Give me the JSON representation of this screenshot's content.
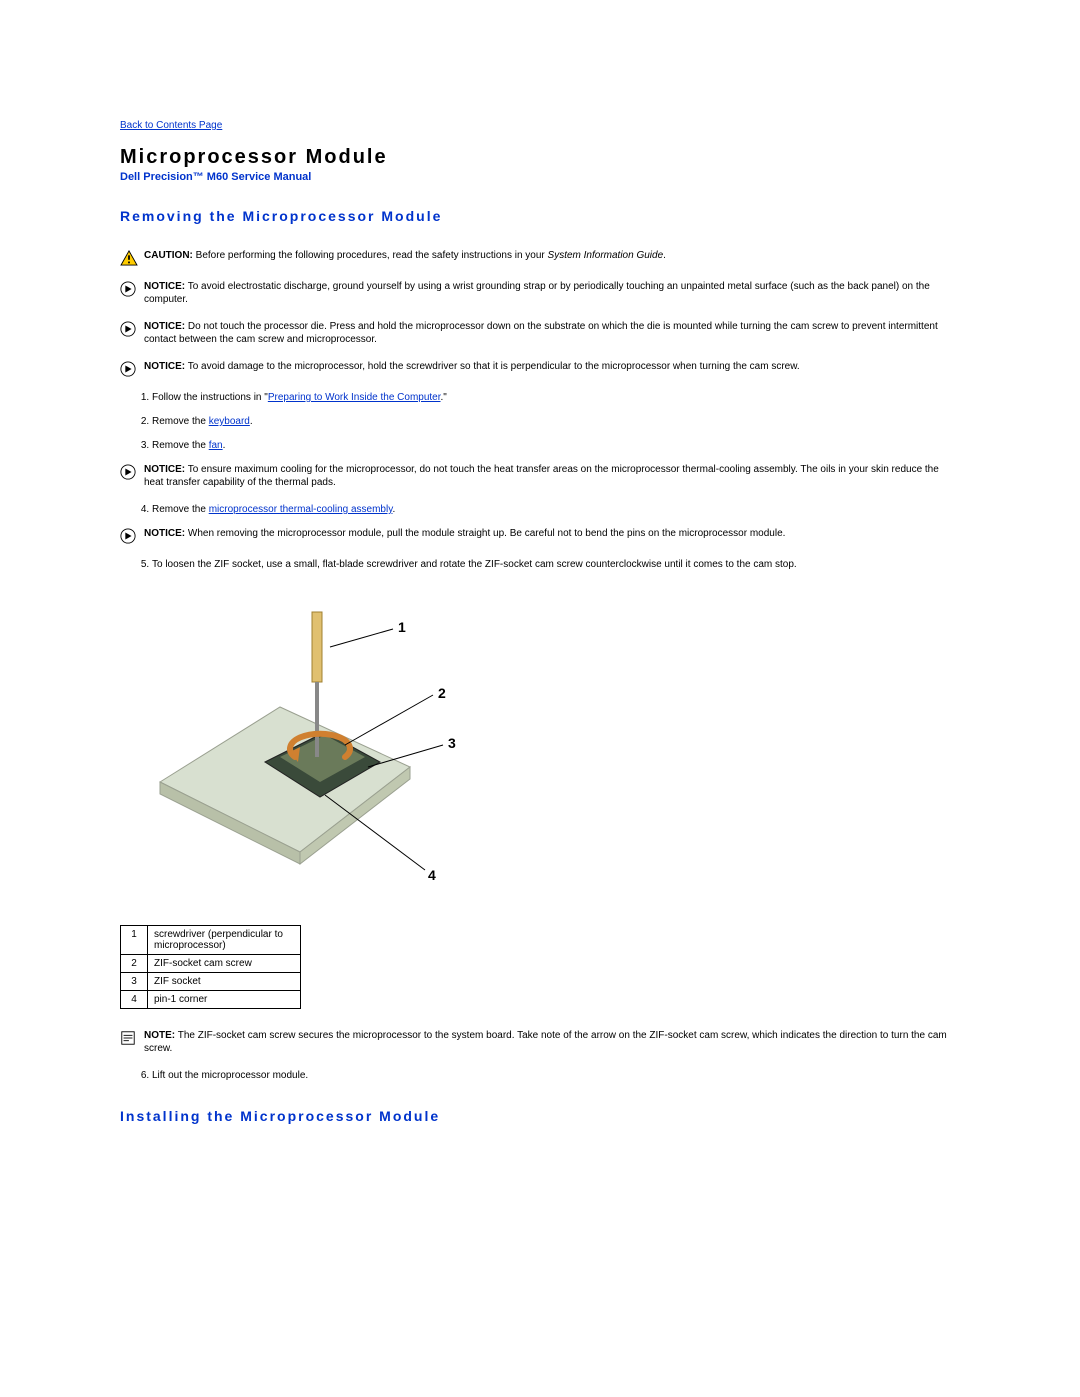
{
  "top_link": "Back to Contents Page",
  "page_title": "Microprocessor Module",
  "subtitle": "Dell Precision™ M60 Service Manual",
  "section1_title": "Removing the Microprocessor Module",
  "caution": {
    "label": "CAUTION:",
    "text": " Before performing the following procedures, read the safety instructions in your ",
    "italic": "System Information Guide",
    "suffix": "."
  },
  "notice1": {
    "label": "NOTICE:",
    "text": " To avoid electrostatic discharge, ground yourself by using a wrist grounding strap or by periodically touching an unpainted metal surface (such as the back panel) on the computer."
  },
  "notice2": {
    "label": "NOTICE:",
    "text": " Do not touch the processor die. Press and hold the microprocessor down on the substrate on which the die is mounted while turning the cam screw to prevent intermittent contact between the cam screw and microprocessor."
  },
  "notice3": {
    "label": "NOTICE:",
    "text": " To avoid damage to the microprocessor, hold the screwdriver so that it is perpendicular to the microprocessor when turning the cam screw."
  },
  "step1_prefix": "Follow the instructions in \"",
  "step1_link": "Preparing to Work Inside the Computer",
  "step1_suffix": ".\"",
  "step2_prefix": "Remove the ",
  "step2_link": "keyboard",
  "step2_suffix": ".",
  "step3_prefix": "Remove the ",
  "step3_link": "fan",
  "step3_suffix": ".",
  "notice4": {
    "label": "NOTICE:",
    "text": " To ensure maximum cooling for the microprocessor, do not touch the heat transfer areas on the microprocessor thermal-cooling assembly. The oils in your skin reduce the heat transfer capability of the thermal pads."
  },
  "step4_prefix": "Remove the ",
  "step4_link": "microprocessor thermal-cooling assembly",
  "step4_suffix": ".",
  "notice5": {
    "label": "NOTICE:",
    "text": " When removing the microprocessor module, pull the module straight up. Be careful not to bend the pins on the microprocessor module."
  },
  "step5": "To loosen the ZIF socket, use a small, flat-blade screwdriver and rotate the ZIF-socket cam screw counterclockwise until it comes to the cam stop.",
  "callouts": {
    "c1": "1",
    "c2": "2",
    "c3": "3",
    "c4": "4"
  },
  "parts": {
    "r1": {
      "n": "1",
      "d": "screwdriver (perpendicular to microprocessor)"
    },
    "r2": {
      "n": "2",
      "d": "ZIF-socket cam screw"
    },
    "r3": {
      "n": "3",
      "d": "ZIF socket"
    },
    "r4": {
      "n": "4",
      "d": "pin-1 corner"
    }
  },
  "note6": {
    "label": "NOTE:",
    "text": " The ZIF-socket cam screw secures the microprocessor to the system board. Take note of the arrow on the ZIF-socket cam screw, which indicates the direction to turn the cam screw."
  },
  "step6": "Lift out the microprocessor module.",
  "section2_title": "Installing the Microprocessor Module"
}
